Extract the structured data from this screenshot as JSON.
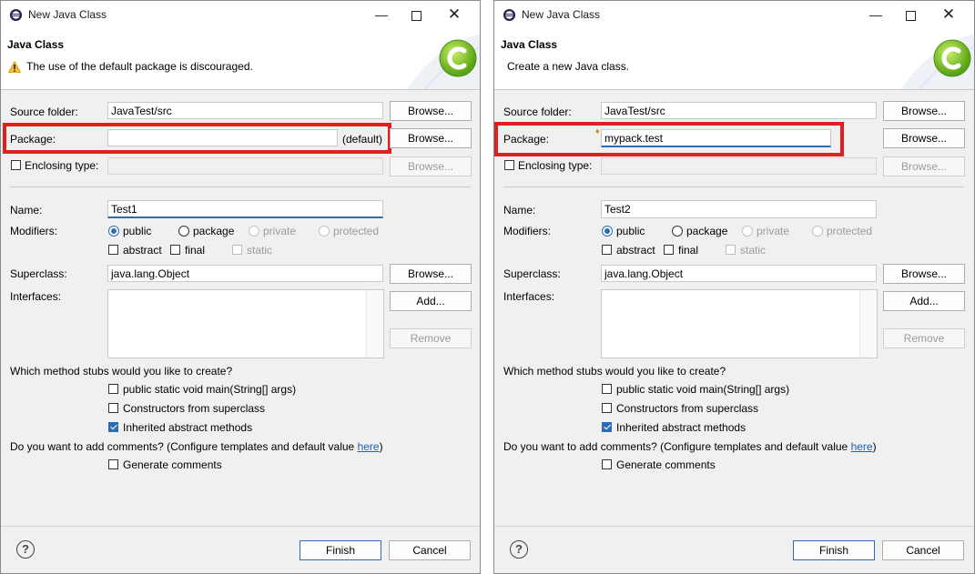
{
  "left": {
    "title": "New Java Class",
    "banner_title": "Java Class",
    "banner_message": "The use of the default package is discouraged.",
    "source_folder_label": "Source folder:",
    "source_folder_value": "JavaTest/src",
    "package_label": "Package:",
    "package_value": "",
    "package_default": "(default)",
    "enclosing_label": "Enclosing type:",
    "name_label": "Name:",
    "name_value": "Test1",
    "modifiers_label": "Modifiers:",
    "mod_public": "public",
    "mod_package": "package",
    "mod_private": "private",
    "mod_protected": "protected",
    "mod_abstract": "abstract",
    "mod_final": "final",
    "mod_static": "static",
    "superclass_label": "Superclass:",
    "superclass_value": "java.lang.Object",
    "interfaces_label": "Interfaces:",
    "browse": "Browse...",
    "add": "Add...",
    "remove": "Remove",
    "stubs_question": "Which method stubs would you like to create?",
    "stub_main": "public static void main(String[] args)",
    "stub_constructors": "Constructors from superclass",
    "stub_inherited": "Inherited abstract methods",
    "comments_question": "Do you want to add comments? (Configure templates and default value ",
    "comments_link": "here",
    "comments_close": ")",
    "generate_comments": "Generate comments",
    "finish": "Finish",
    "cancel": "Cancel"
  },
  "right": {
    "title": "New Java Class",
    "banner_title": "Java Class",
    "banner_message": "Create a new Java class.",
    "source_folder_label": "Source folder:",
    "source_folder_value": "JavaTest/src",
    "package_label": "Package:",
    "package_value": "mypack.test",
    "enclosing_label": "Enclosing type:",
    "name_label": "Name:",
    "name_value": "Test2",
    "modifiers_label": "Modifiers:",
    "mod_public": "public",
    "mod_package": "package",
    "mod_private": "private",
    "mod_protected": "protected",
    "mod_abstract": "abstract",
    "mod_final": "final",
    "mod_static": "static",
    "superclass_label": "Superclass:",
    "superclass_value": "java.lang.Object",
    "interfaces_label": "Interfaces:",
    "browse": "Browse...",
    "add": "Add...",
    "remove": "Remove",
    "stubs_question": "Which method stubs would you like to create?",
    "stub_main": "public static void main(String[] args)",
    "stub_constructors": "Constructors from superclass",
    "stub_inherited": "Inherited abstract methods",
    "comments_question": "Do you want to add comments? (Configure templates and default value ",
    "comments_link": "here",
    "comments_close": ")",
    "generate_comments": "Generate comments",
    "finish": "Finish",
    "cancel": "Cancel"
  },
  "colors": {
    "highlight": "#e0201e",
    "accent": "#2c6cb4",
    "logo_green": "#7cc21f"
  },
  "icons": {
    "app": "eclipse-icon",
    "warning": "warning-icon",
    "logo": "java-class-c-icon",
    "help": "help-icon"
  }
}
